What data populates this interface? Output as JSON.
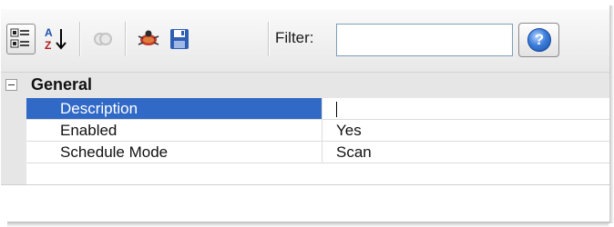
{
  "toolbar": {
    "buttons": [
      {
        "name": "categorized-view-button",
        "icon": "categorized-icon",
        "pressed": true
      },
      {
        "name": "alphabetical-sort-button",
        "icon": "sort-az-icon",
        "pressed": false
      },
      {
        "name": "property-pages-button",
        "icon": "property-pages-icon",
        "pressed": false,
        "disabled": true
      },
      {
        "name": "debug-button",
        "icon": "bug-icon",
        "pressed": false
      },
      {
        "name": "save-button",
        "icon": "save-icon",
        "pressed": false
      }
    ],
    "filter_label": "Filter:",
    "filter_value": "",
    "help_icon": "help-icon",
    "help_glyph": "?"
  },
  "grid": {
    "category": "General",
    "properties": [
      {
        "name": "Description",
        "value": "",
        "selected": true
      },
      {
        "name": "Enabled",
        "value": "Yes",
        "selected": false
      },
      {
        "name": "Schedule Mode",
        "value": "Scan",
        "selected": false
      }
    ]
  },
  "colors": {
    "selection": "#3169c6",
    "category_bg": "#e6e6e6",
    "help_blue": "#3d7fdc"
  }
}
